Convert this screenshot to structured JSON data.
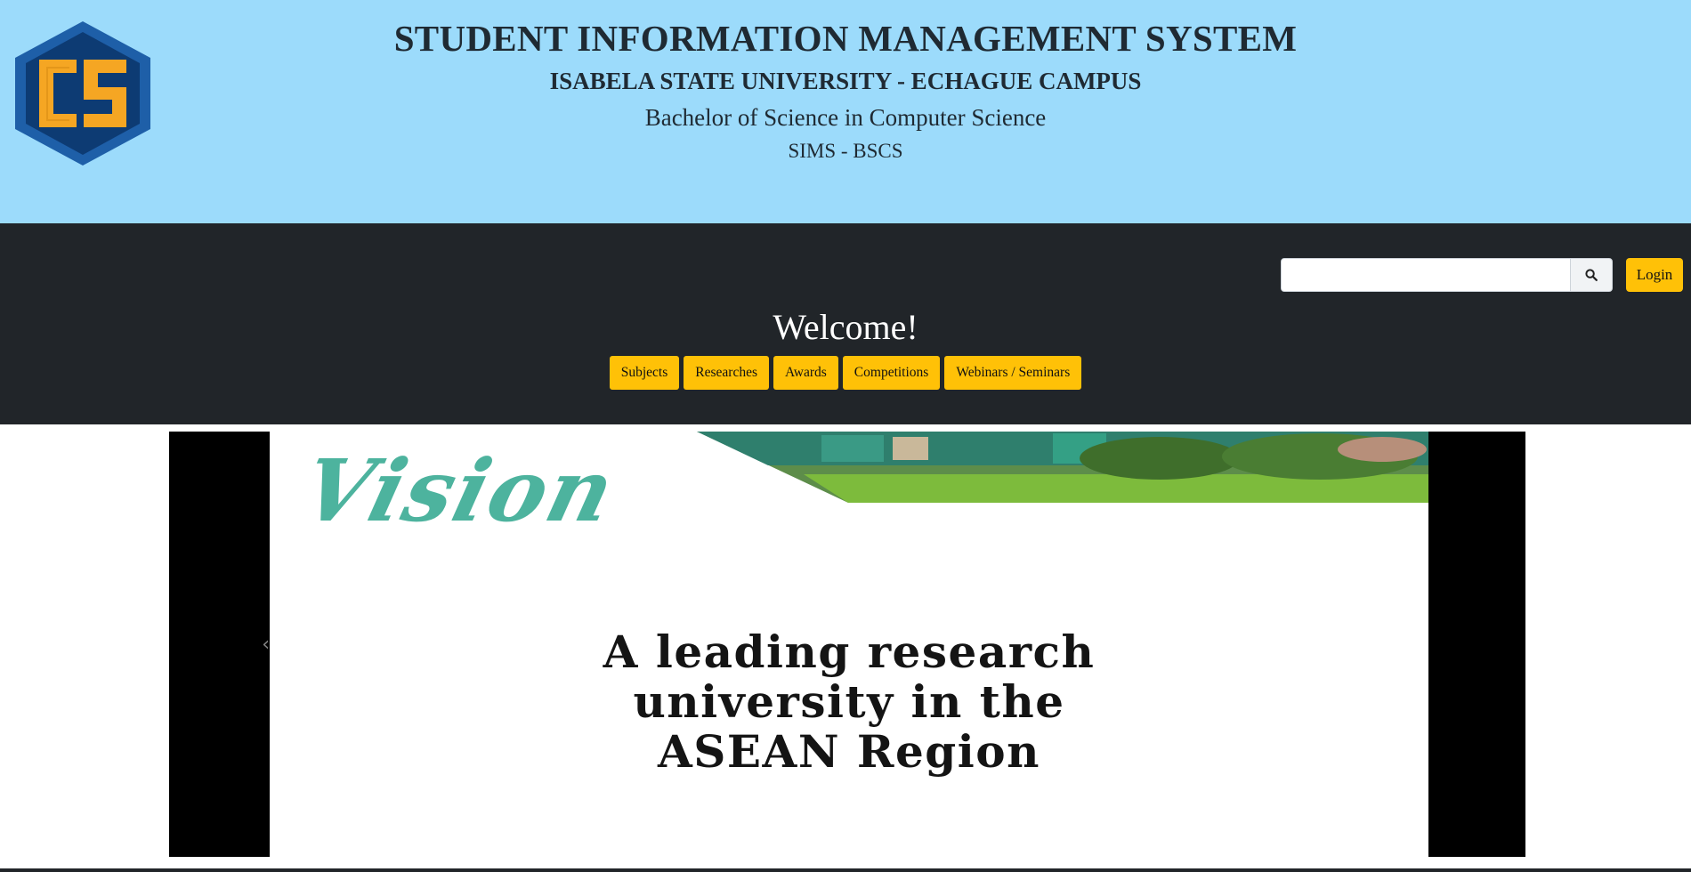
{
  "header": {
    "logo_text": "CS",
    "title": "STUDENT INFORMATION MANAGEMENT SYSTEM",
    "university": "ISABELA STATE UNIVERSITY - ECHAGUE CAMPUS",
    "program": "Bachelor of Science in Computer Science",
    "abbreviation": "SIMS - BSCS"
  },
  "navbar": {
    "search_value": "",
    "search_placeholder": "",
    "login_label": "Login",
    "welcome": "Welcome!",
    "buttons": [
      "Subjects",
      "Researches",
      "Awards",
      "Competitions",
      "Webinars / Seminars"
    ]
  },
  "carousel": {
    "slide_heading": "Vision",
    "slide_lines": [
      "A leading research",
      "university in the",
      "ASEAN Region"
    ],
    "prev_icon": "chevron-left-icon",
    "next_icon": "chevron-right-icon"
  },
  "colors": {
    "header_bg": "#9cdbfb",
    "navbar_bg": "#212529",
    "button_accent": "#ffc107",
    "vision_teal": "#4db39e"
  }
}
